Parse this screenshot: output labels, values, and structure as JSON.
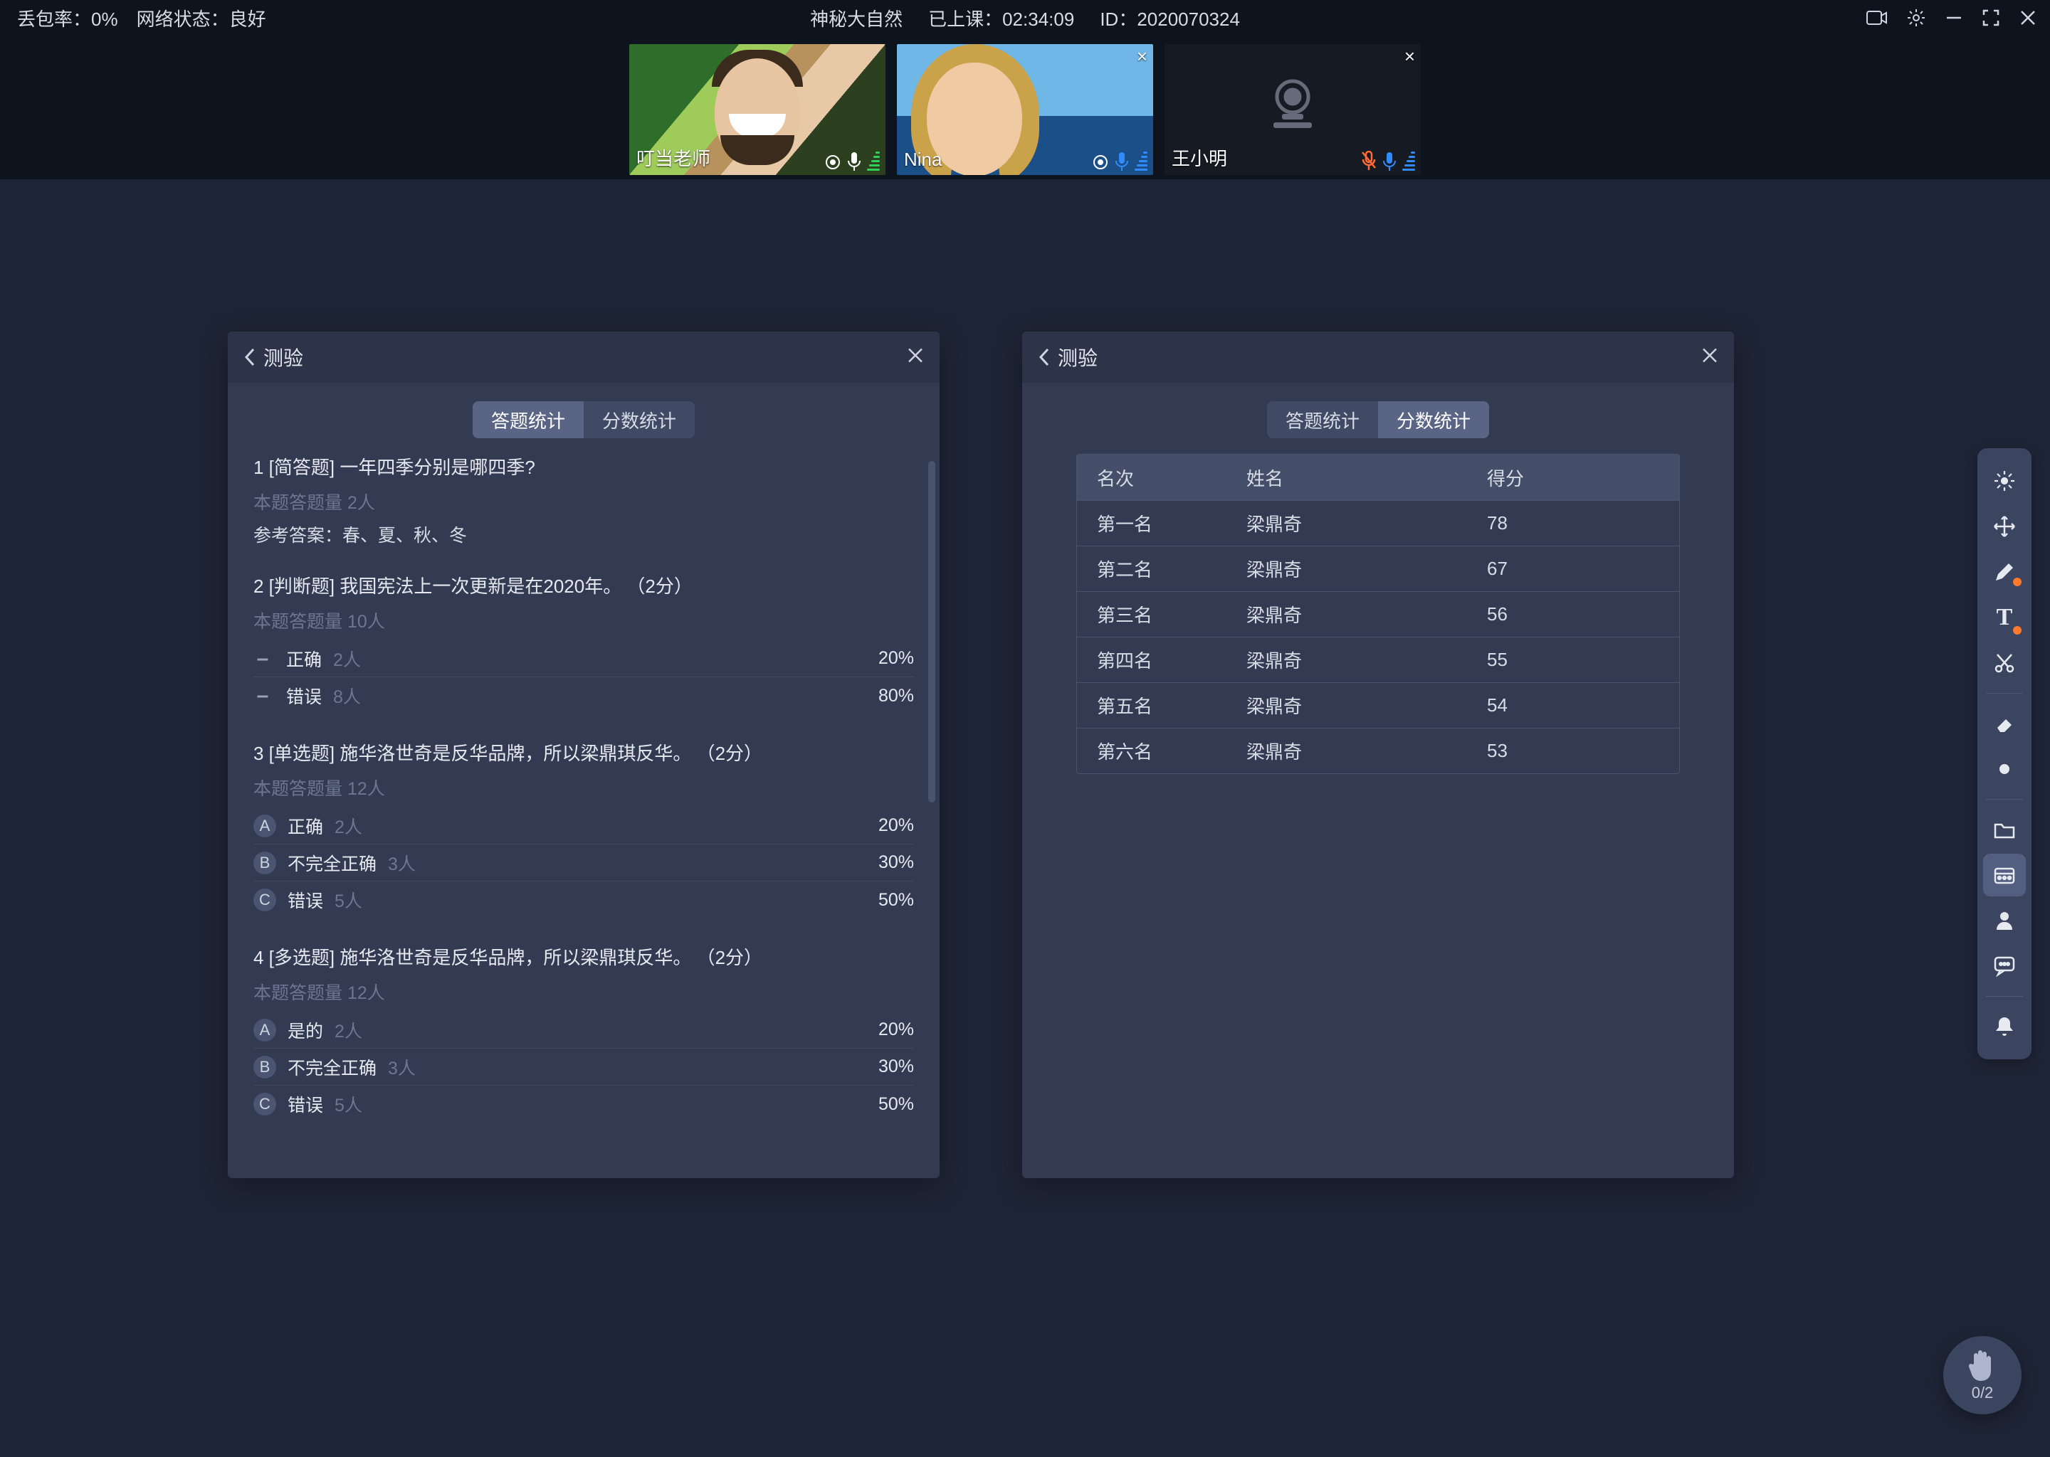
{
  "topbar": {
    "loss_label": "丢包率：",
    "loss_value": "0%",
    "net_label": "网络状态：",
    "net_value": "良好",
    "title": "神秘大自然",
    "elapsed_label": "已上课：",
    "elapsed_value": "02:34:09",
    "id_label": "ID：",
    "id_value": "2020070324"
  },
  "videos": [
    {
      "name": "叮当老师",
      "camera_on": true,
      "closable": false,
      "mic_color": "green",
      "ring": true
    },
    {
      "name": "Nina",
      "camera_on": true,
      "closable": true,
      "mic_color": "blue",
      "ring": true
    },
    {
      "name": "王小明",
      "camera_on": false,
      "closable": true,
      "mic_color": "blue",
      "mic_muted": true
    }
  ],
  "quiz": {
    "title": "测验",
    "tabs": {
      "answer": "答题统计",
      "score": "分数统计"
    },
    "questions": [
      {
        "num": "1",
        "type": "[简答题]",
        "text": "一年四季分别是哪四季?",
        "meta": "本题答题量 2人",
        "reference": "参考答案：春、夏、秋、冬",
        "options": []
      },
      {
        "num": "2",
        "type": "[判断题]",
        "text": "我国宪法上一次更新是在2020年。",
        "pts": "（2分）",
        "meta": "本题答题量 10人",
        "options": [
          {
            "badge": "—",
            "kind": "dash",
            "label": "正确",
            "count": "2人",
            "pct": "20%"
          },
          {
            "badge": "—",
            "kind": "dash",
            "label": "错误",
            "count": "8人",
            "pct": "80%"
          }
        ]
      },
      {
        "num": "3",
        "type": "[单选题]",
        "text": "施华洛世奇是反华品牌，所以梁鼎琪反华。",
        "pts": "（2分）",
        "meta": "本题答题量 12人",
        "options": [
          {
            "badge": "A",
            "label": "正确",
            "count": "2人",
            "pct": "20%"
          },
          {
            "badge": "B",
            "label": "不完全正确",
            "count": "3人",
            "pct": "30%"
          },
          {
            "badge": "C",
            "label": "错误",
            "count": "5人",
            "pct": "50%"
          }
        ]
      },
      {
        "num": "4",
        "type": "[多选题]",
        "text": "施华洛世奇是反华品牌，所以梁鼎琪反华。",
        "pts": "（2分）",
        "meta": "本题答题量 12人",
        "options": [
          {
            "badge": "A",
            "label": "是的",
            "count": "2人",
            "pct": "20%"
          },
          {
            "badge": "B",
            "label": "不完全正确",
            "count": "3人",
            "pct": "30%"
          },
          {
            "badge": "C",
            "label": "错误",
            "count": "5人",
            "pct": "50%"
          }
        ]
      }
    ],
    "score_table": {
      "headers": {
        "rank": "名次",
        "name": "姓名",
        "score": "得分"
      },
      "rows": [
        {
          "rank": "第一名",
          "name": "梁鼎奇",
          "score": "78"
        },
        {
          "rank": "第二名",
          "name": "梁鼎奇",
          "score": "67"
        },
        {
          "rank": "第三名",
          "name": "梁鼎奇",
          "score": "56"
        },
        {
          "rank": "第四名",
          "name": "梁鼎奇",
          "score": "55"
        },
        {
          "rank": "第五名",
          "name": "梁鼎奇",
          "score": "54"
        },
        {
          "rank": "第六名",
          "name": "梁鼎奇",
          "score": "53"
        }
      ]
    }
  },
  "hand": {
    "count": "0/2"
  },
  "tools": [
    "laser",
    "move",
    "pencil",
    "text",
    "scissors",
    "eraser",
    "dot",
    "folder",
    "library",
    "person",
    "chat",
    "bell"
  ]
}
